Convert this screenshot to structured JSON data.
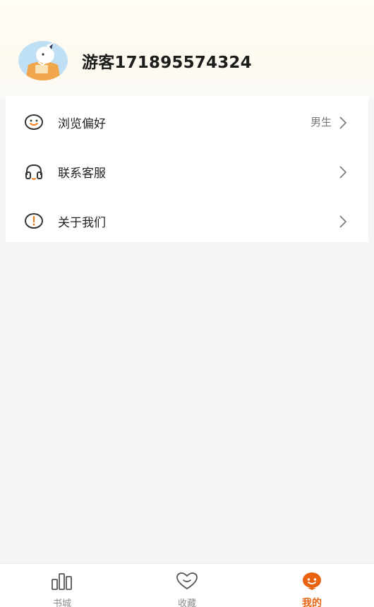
{
  "profile": {
    "username": "游客171895574324"
  },
  "menu": {
    "items": [
      {
        "label": "浏览偏好",
        "value": "男生",
        "icon": "smile-icon"
      },
      {
        "label": "联系客服",
        "value": "",
        "icon": "headset-icon"
      },
      {
        "label": "关于我们",
        "value": "",
        "icon": "info-icon"
      }
    ]
  },
  "tabbar": {
    "active_color": "#e8620f",
    "tabs": [
      {
        "label": "书城",
        "icon": "bookstore-icon",
        "active": false
      },
      {
        "label": "收藏",
        "icon": "heart-icon",
        "active": false
      },
      {
        "label": "我的",
        "icon": "profile-face-icon",
        "active": true
      }
    ]
  }
}
